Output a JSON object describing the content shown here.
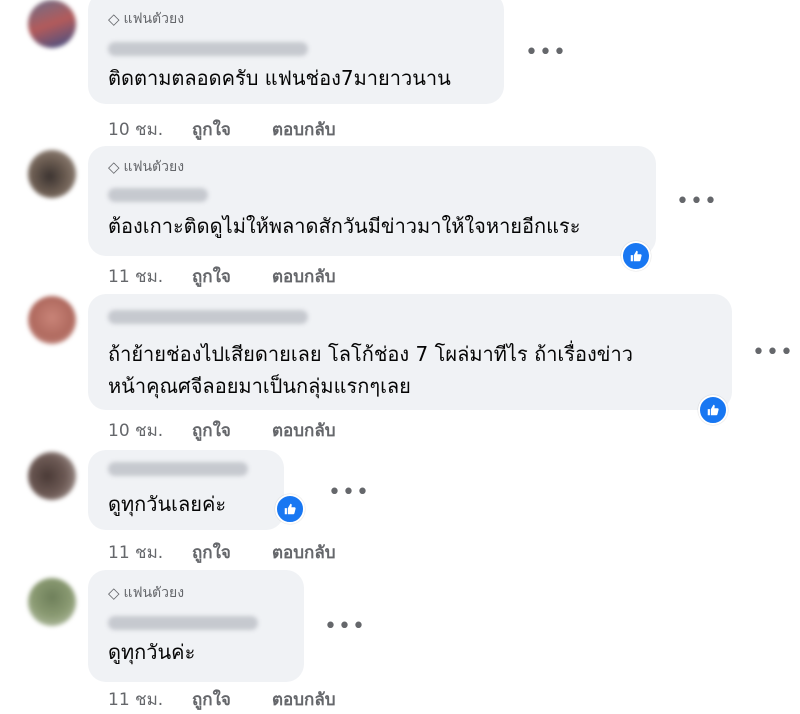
{
  "badge_label": "แฟนตัวยง",
  "action_like": "ถูกใจ",
  "action_reply": "ตอบกลับ",
  "comments": [
    {
      "text_lines": [
        "ติดตามตลอดครับ แฟนช่อง7มายาวนาน"
      ],
      "time": "10 ชม.",
      "has_badge": true,
      "reactions": false
    },
    {
      "text_lines": [
        "ต้องเกาะติดดูไม่ให้พลาดสักวันมีข่าวมาให้ใจหายอีกแระ"
      ],
      "time": "11 ชม.",
      "has_badge": true,
      "reactions": true
    },
    {
      "text_lines": [
        "ถ้าย้ายช่องไปเสียดายเลย โลโก้ช่อง 7 โผล่มาทีไร ถ้าเรื่องข่าว",
        "หน้าคุณศจีลอยมาเป็นกลุ่มแรกๆเลย"
      ],
      "time": "10 ชม.",
      "has_badge": false,
      "reactions": true
    },
    {
      "text_lines": [
        "ดูทุกวันเลยค่ะ"
      ],
      "time": "11 ชม.",
      "has_badge": false,
      "reactions": true
    },
    {
      "text_lines": [
        "ดูทุกวันค่ะ"
      ],
      "time": "11 ชม.",
      "has_badge": true,
      "reactions": false
    }
  ],
  "colors": {
    "like_blue": "#1877f2",
    "bubble": "#f0f2f5",
    "meta": "#65676b"
  },
  "icons": {
    "badge": "diamond-icon",
    "more": "more-options-icon",
    "reaction": "thumbs-up-icon"
  }
}
